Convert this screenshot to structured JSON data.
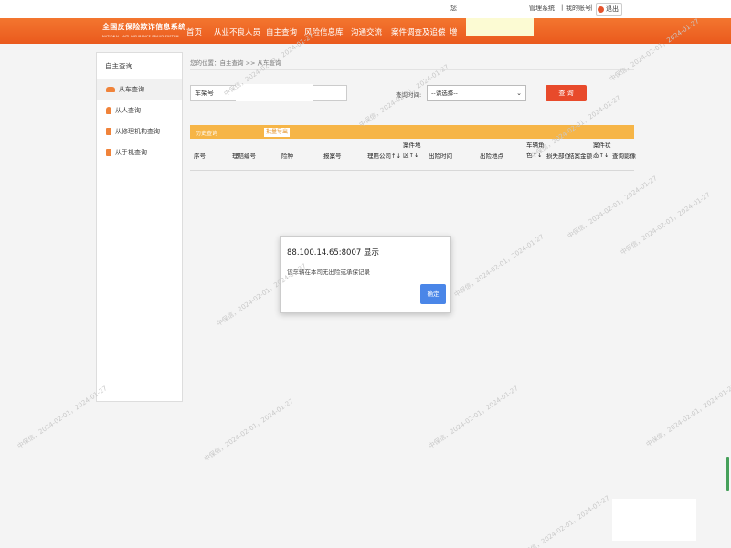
{
  "topbar": {
    "fragment": "您",
    "management_system": "管理系统",
    "separator1": "|",
    "my_account": "我的账号",
    "separator2": "|",
    "logout": "退出"
  },
  "header": {
    "logo_title": "全国反保险欺诈信息系统",
    "logo_subtitle": "NATIONAL ANTI INSURANCE FRAUD SYSTEM",
    "nav_items": [
      "首页",
      "从业不良人员",
      "自主查询",
      "风险信息库",
      "沟通交流",
      "案件调查及追偿",
      "增"
    ]
  },
  "sidebar": {
    "title": "自主查询",
    "items": [
      {
        "label": "从车查询",
        "icon": "car-icon"
      },
      {
        "label": "从人查询",
        "icon": "person-icon"
      },
      {
        "label": "从修理机构查询",
        "icon": "repair-shop-icon"
      },
      {
        "label": "从手机查询",
        "icon": "phone-icon"
      }
    ]
  },
  "main": {
    "breadcrumb": "您的位置：自主查询 >> 从车查询",
    "search_input_value": "车架号",
    "date_label": "查询时间:",
    "select_value": "--请选择--",
    "query_button": "查 询",
    "history_label": "历史查询",
    "export_button": "批量导出",
    "table_headers": [
      "序号",
      "理赔编号",
      "险种",
      "报案号",
      "理赔公司↑↓",
      "案件地区↑↓",
      "出险时间",
      "出险地点",
      "车辆角色↑↓",
      "损失部位",
      "结案金额",
      "案件状态↑↓",
      "查询影像"
    ]
  },
  "dialog": {
    "title": "88.100.14.65:8007 显示",
    "message": "该车辆在本司无出险或承保记录",
    "ok_button": "确定"
  },
  "watermark": "中保信，2024-02-01，2024-01-27"
}
